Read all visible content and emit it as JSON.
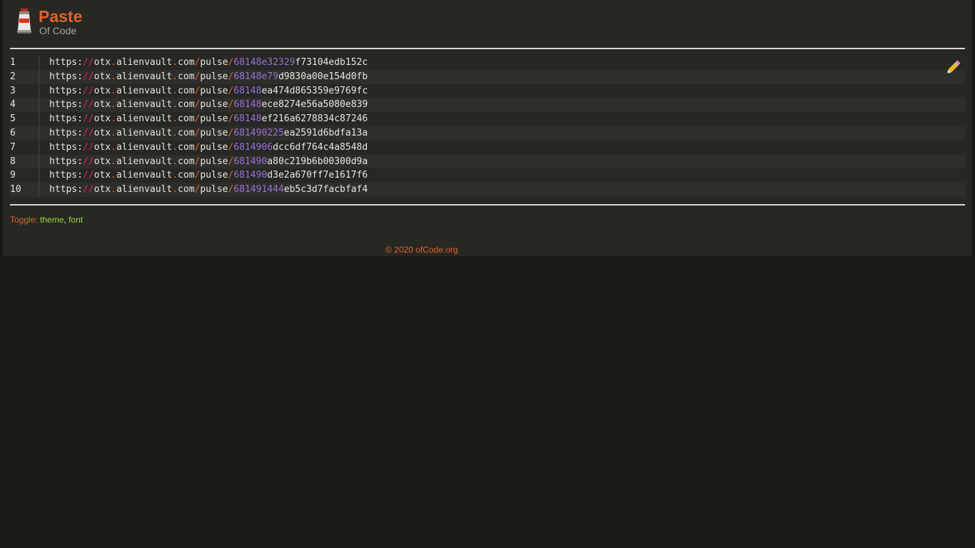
{
  "header": {
    "title": "Paste",
    "subtitle": "Of Code",
    "logo_icon": "paint-tube-icon"
  },
  "code": {
    "lines": [
      {
        "num": "1",
        "scheme": "https:",
        "slashes": "//",
        "host1": "otx",
        "dot1": ".",
        "host2": "alienvault",
        "dot2": ".",
        "host3": "com",
        "sep1": "/",
        "path": "pulse",
        "sep2": "/",
        "id_num": "68148e32329",
        "id_hex": "f73104edb152c"
      },
      {
        "num": "2",
        "scheme": "https:",
        "slashes": "//",
        "host1": "otx",
        "dot1": ".",
        "host2": "alienvault",
        "dot2": ".",
        "host3": "com",
        "sep1": "/",
        "path": "pulse",
        "sep2": "/",
        "id_num": "68148e79",
        "id_hex": "d9830a00e154d0fb"
      },
      {
        "num": "3",
        "scheme": "https:",
        "slashes": "//",
        "host1": "otx",
        "dot1": ".",
        "host2": "alienvault",
        "dot2": ".",
        "host3": "com",
        "sep1": "/",
        "path": "pulse",
        "sep2": "/",
        "id_num": "68148",
        "id_hex": "ea474d865359e9769fc"
      },
      {
        "num": "4",
        "scheme": "https:",
        "slashes": "//",
        "host1": "otx",
        "dot1": ".",
        "host2": "alienvault",
        "dot2": ".",
        "host3": "com",
        "sep1": "/",
        "path": "pulse",
        "sep2": "/",
        "id_num": "68148",
        "id_hex": "ece8274e56a5080e839"
      },
      {
        "num": "5",
        "scheme": "https:",
        "slashes": "//",
        "host1": "otx",
        "dot1": ".",
        "host2": "alienvault",
        "dot2": ".",
        "host3": "com",
        "sep1": "/",
        "path": "pulse",
        "sep2": "/",
        "id_num": "68148",
        "id_hex": "ef216a6278834c87246"
      },
      {
        "num": "6",
        "scheme": "https:",
        "slashes": "//",
        "host1": "otx",
        "dot1": ".",
        "host2": "alienvault",
        "dot2": ".",
        "host3": "com",
        "sep1": "/",
        "path": "pulse",
        "sep2": "/",
        "id_num": "681490225",
        "id_hex": "ea2591d6bdfa13a"
      },
      {
        "num": "7",
        "scheme": "https:",
        "slashes": "//",
        "host1": "otx",
        "dot1": ".",
        "host2": "alienvault",
        "dot2": ".",
        "host3": "com",
        "sep1": "/",
        "path": "pulse",
        "sep2": "/",
        "id_num": "6814906",
        "id_hex": "dcc6df764c4a8548d"
      },
      {
        "num": "8",
        "scheme": "https:",
        "slashes": "//",
        "host1": "otx",
        "dot1": ".",
        "host2": "alienvault",
        "dot2": ".",
        "host3": "com",
        "sep1": "/",
        "path": "pulse",
        "sep2": "/",
        "id_num": "681490",
        "id_hex": "a80c219b6b00300d9a"
      },
      {
        "num": "9",
        "scheme": "https:",
        "slashes": "//",
        "host1": "otx",
        "dot1": ".",
        "host2": "alienvault",
        "dot2": ".",
        "host3": "com",
        "sep1": "/",
        "path": "pulse",
        "sep2": "/",
        "id_num": "681490",
        "id_hex": "d3e2a670ff7e1617f6"
      },
      {
        "num": "10",
        "scheme": "https:",
        "slashes": "//",
        "host1": "otx",
        "dot1": ".",
        "host2": "alienvault",
        "dot2": ".",
        "host3": "com",
        "sep1": "/",
        "path": "pulse",
        "sep2": "/",
        "id_num": "681491444",
        "id_hex": "eb5c3d7facbfaf4"
      }
    ],
    "edit_icon": "pencil-icon"
  },
  "toggle": {
    "label": "Toggle:",
    "theme": "theme",
    "comma": ",",
    "font": "font"
  },
  "footer": {
    "copyright": "© 2020 ofCode.org"
  },
  "colors": {
    "accent": "#e2632a",
    "link": "#9ed83a",
    "number": "#9a70d8",
    "slashes": "#e0245a",
    "panel": "#272723",
    "background": "#181814"
  }
}
